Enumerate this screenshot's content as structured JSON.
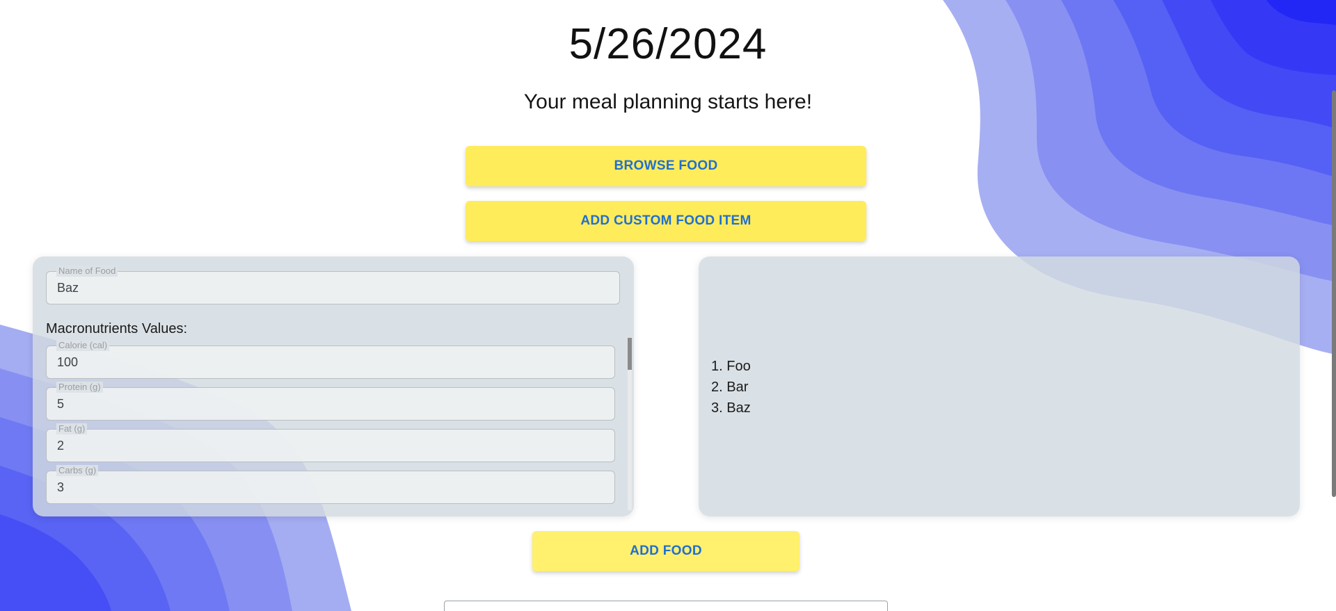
{
  "header": {
    "date": "5/26/2024",
    "tagline": "Your meal planning starts here!"
  },
  "actions": {
    "browse_label": "BROWSE FOOD",
    "custom_label": "ADD CUSTOM FOOD ITEM",
    "add_label": "ADD FOOD"
  },
  "form": {
    "name_legend": "Name of Food",
    "name_value": "Baz",
    "macros_title": "Macronutrients Values:",
    "fields": [
      {
        "legend": "Calorie (cal)",
        "value": "100"
      },
      {
        "legend": "Protein (g)",
        "value": "5"
      },
      {
        "legend": "Fat (g)",
        "value": "2"
      },
      {
        "legend": "Carbs (g)",
        "value": "3"
      }
    ]
  },
  "food_list": {
    "items": [
      "1. Foo",
      "2. Bar",
      "3. Baz"
    ]
  },
  "colors": {
    "button_bg": "#ffec5a",
    "button_text": "#1f6fd1",
    "panel_bg": "#d2dae0",
    "wave_dark": "#3a3df5",
    "wave_light": "#9aa4f2"
  }
}
